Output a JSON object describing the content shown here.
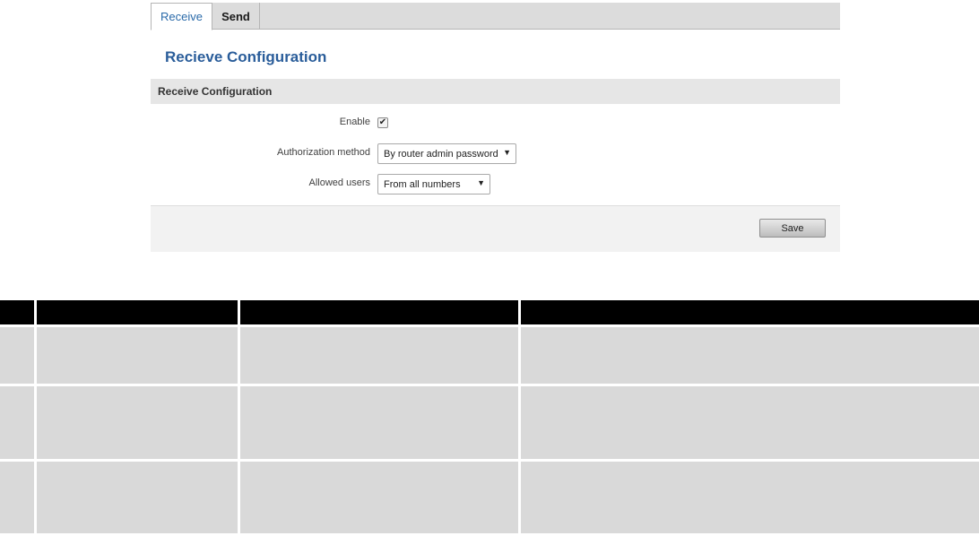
{
  "tabs": [
    {
      "label": "Receive",
      "active": true
    },
    {
      "label": "Send",
      "active": false
    }
  ],
  "page_title": "Recieve Configuration",
  "section": {
    "title": "Receive Configuration",
    "fields": {
      "enable": {
        "label": "Enable",
        "checked": true,
        "check_glyph": "✔"
      },
      "auth_method": {
        "label": "Authorization method",
        "value": "By router admin password"
      },
      "allowed_users": {
        "label": "Allowed users",
        "value": "From all numbers"
      }
    }
  },
  "actions": {
    "save_label": "Save"
  },
  "dropdown_arrow": "▼",
  "colors": {
    "title_blue": "#2a5d9a",
    "active_tab_text": "#2a6aa9",
    "section_bg": "#e6e6e6",
    "table_header": "#000000",
    "table_cell": "#d9d9d9"
  },
  "doc_table": {
    "header": [
      "",
      "",
      "",
      ""
    ],
    "rows": [
      [
        "",
        "",
        "",
        ""
      ],
      [
        "",
        "",
        "",
        ""
      ],
      [
        "",
        "",
        "",
        ""
      ]
    ]
  }
}
